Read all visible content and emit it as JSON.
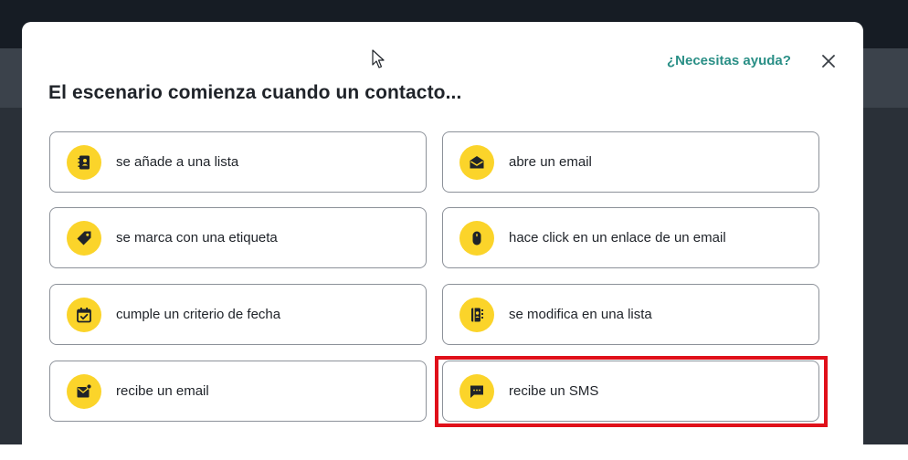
{
  "modal": {
    "title": "El escenario comienza cuando un contacto...",
    "help_link": "¿Necesitas ayuda?",
    "options": [
      {
        "label": "se añade a una lista",
        "icon": "contact-book-icon"
      },
      {
        "label": "abre un email",
        "icon": "open-envelope-icon"
      },
      {
        "label": "se marca con una etiqueta",
        "icon": "tag-icon"
      },
      {
        "label": "hace click en un enlace de un email",
        "icon": "mouse-icon"
      },
      {
        "label": "cumple un criterio de fecha",
        "icon": "calendar-check-icon"
      },
      {
        "label": "se modifica en una lista",
        "icon": "contact-edit-icon"
      },
      {
        "label": "recibe un email",
        "icon": "envelope-notification-icon"
      },
      {
        "label": "recibe un SMS",
        "icon": "sms-bubble-icon"
      }
    ]
  },
  "colors": {
    "accent": "#fbd42a",
    "link": "#2a8f86",
    "highlight": "#e0101a"
  }
}
